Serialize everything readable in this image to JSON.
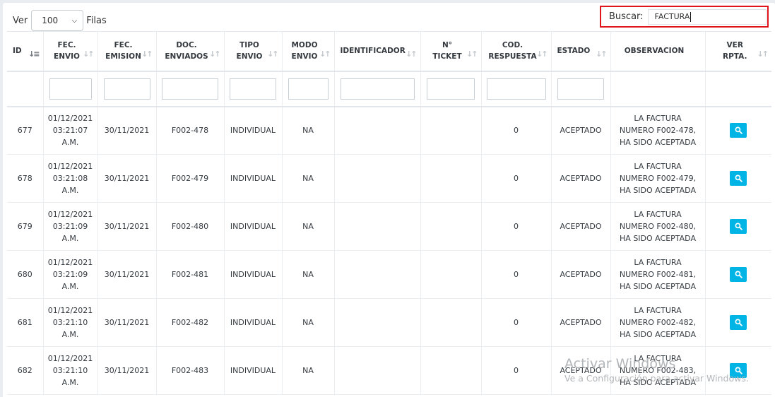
{
  "length_control": {
    "prefix": "Ver",
    "value": "100",
    "suffix": "Filas"
  },
  "search": {
    "label": "Buscar:",
    "value": "FACTURA"
  },
  "columns": [
    {
      "l1": "ID",
      "l2": ""
    },
    {
      "l1": "FEC.",
      "l2": "ENVIO"
    },
    {
      "l1": "FEC.",
      "l2": "EMISION"
    },
    {
      "l1": "DOC.",
      "l2": "ENVIADOS"
    },
    {
      "l1": "TIPO",
      "l2": "ENVIO"
    },
    {
      "l1": "MODO",
      "l2": "ENVIO"
    },
    {
      "l1": "IDENTIFICADOR",
      "l2": ""
    },
    {
      "l1": "N°",
      "l2": "TICKET"
    },
    {
      "l1": "COD.",
      "l2": "RESPUESTA"
    },
    {
      "l1": "ESTADO",
      "l2": ""
    },
    {
      "l1": "OBSERVACION",
      "l2": ""
    },
    {
      "l1": "VER",
      "l2": "RPTA."
    }
  ],
  "rows": [
    {
      "id": "677",
      "fec_envio": [
        "01/12/2021",
        "03:21:07",
        "A.M."
      ],
      "fec_emision": "30/11/2021",
      "doc": "F002-478",
      "tipo": "INDIVIDUAL",
      "modo": "NA",
      "identificador": "",
      "ticket": "",
      "cod": "0",
      "estado": "ACEPTADO",
      "obs": [
        "LA FACTURA",
        "NUMERO F002-478,",
        "HA SIDO ACEPTADA"
      ]
    },
    {
      "id": "678",
      "fec_envio": [
        "01/12/2021",
        "03:21:08",
        "A.M."
      ],
      "fec_emision": "30/11/2021",
      "doc": "F002-479",
      "tipo": "INDIVIDUAL",
      "modo": "NA",
      "identificador": "",
      "ticket": "",
      "cod": "0",
      "estado": "ACEPTADO",
      "obs": [
        "LA FACTURA",
        "NUMERO F002-479,",
        "HA SIDO ACEPTADA"
      ]
    },
    {
      "id": "679",
      "fec_envio": [
        "01/12/2021",
        "03:21:09",
        "A.M."
      ],
      "fec_emision": "30/11/2021",
      "doc": "F002-480",
      "tipo": "INDIVIDUAL",
      "modo": "NA",
      "identificador": "",
      "ticket": "",
      "cod": "0",
      "estado": "ACEPTADO",
      "obs": [
        "LA FACTURA",
        "NUMERO F002-480,",
        "HA SIDO ACEPTADA"
      ]
    },
    {
      "id": "680",
      "fec_envio": [
        "01/12/2021",
        "03:21:09",
        "A.M."
      ],
      "fec_emision": "30/11/2021",
      "doc": "F002-481",
      "tipo": "INDIVIDUAL",
      "modo": "NA",
      "identificador": "",
      "ticket": "",
      "cod": "0",
      "estado": "ACEPTADO",
      "obs": [
        "LA FACTURA",
        "NUMERO F002-481,",
        "HA SIDO ACEPTADA"
      ]
    },
    {
      "id": "681",
      "fec_envio": [
        "01/12/2021",
        "03:21:10",
        "A.M."
      ],
      "fec_emision": "30/11/2021",
      "doc": "F002-482",
      "tipo": "INDIVIDUAL",
      "modo": "NA",
      "identificador": "",
      "ticket": "",
      "cod": "0",
      "estado": "ACEPTADO",
      "obs": [
        "LA FACTURA",
        "NUMERO F002-482,",
        "HA SIDO ACEPTADA"
      ]
    },
    {
      "id": "682",
      "fec_envio": [
        "01/12/2021",
        "03:21:10",
        "A.M."
      ],
      "fec_emision": "30/11/2021",
      "doc": "F002-483",
      "tipo": "INDIVIDUAL",
      "modo": "NA",
      "identificador": "",
      "ticket": "",
      "cod": "0",
      "estado": "ACEPTADO",
      "obs": [
        "LA FACTURA",
        "NUMERO F002-483,",
        "HA SIDO ACEPTADA"
      ]
    }
  ],
  "watermark": {
    "line1": "Activar Windows",
    "line2": "Ve a Configuración para activar Windows."
  },
  "colors": {
    "search_highlight": "#e0161d",
    "view_button": "#00b5e5"
  }
}
